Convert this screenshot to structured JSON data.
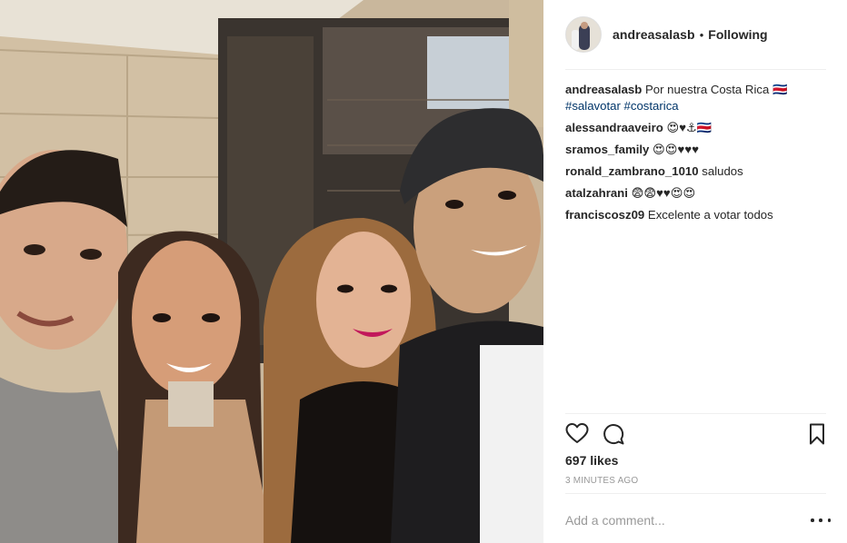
{
  "post": {
    "username": "andreasalasb",
    "separator": "•",
    "follow_status": "Following",
    "caption": {
      "username": "andreasalasb",
      "text": "Por nuestra Costa Rica 🇨🇷",
      "hashtags": [
        "#salavotar",
        "#costarica"
      ]
    },
    "comments": [
      {
        "username": "alessandraaveiro",
        "text": "😍♥⚓🇨🇷"
      },
      {
        "username": "sramos_family",
        "text": "😍😍♥♥♥"
      },
      {
        "username": "ronald_zambrano_1010",
        "text": "saludos"
      },
      {
        "username": "atalzahrani",
        "text": "😨😨♥♥😍😍"
      },
      {
        "username": "franciscosz09",
        "text": "Excelente a votar todos"
      }
    ],
    "likes": "697 likes",
    "timestamp": "3 MINUTES AGO",
    "comment_placeholder": "Add a comment..."
  },
  "icons": {
    "like": "heart-outline-icon",
    "comment": "speech-bubble-icon",
    "save": "bookmark-icon",
    "more": "ellipsis-icon"
  },
  "colors": {
    "text": "#262626",
    "hashtag": "#003569",
    "muted": "#999999",
    "divider": "#efefef"
  }
}
